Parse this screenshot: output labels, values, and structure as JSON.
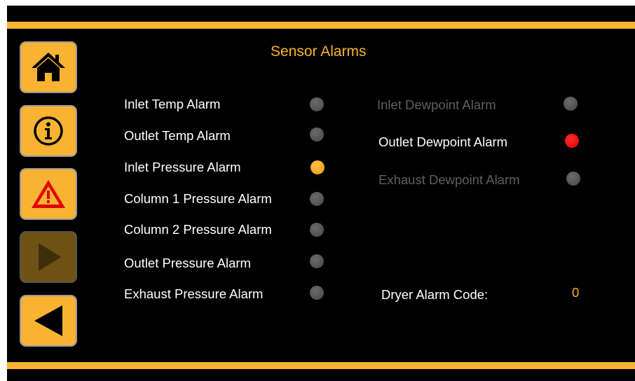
{
  "title": "Sensor Alarms",
  "nav": [
    {
      "name": "home",
      "icon": "home-icon",
      "enabled": true
    },
    {
      "name": "info",
      "icon": "info-icon",
      "enabled": true
    },
    {
      "name": "alarms",
      "icon": "warning-icon",
      "enabled": true
    },
    {
      "name": "next",
      "icon": "play-right-icon",
      "enabled": false
    },
    {
      "name": "back",
      "icon": "arrow-left-icon",
      "enabled": true
    }
  ],
  "left_alarms": [
    {
      "label": "Inlet Temp Alarm",
      "state": "off"
    },
    {
      "label": "Outlet Temp Alarm",
      "state": "off"
    },
    {
      "label": "Inlet Pressure Alarm",
      "state": "yellow"
    },
    {
      "label": "Column 1 Pressure Alarm",
      "state": "off"
    },
    {
      "label": "Column 2 Pressure Alarm",
      "state": "off"
    },
    {
      "label": "Outlet Pressure Alarm",
      "state": "off"
    },
    {
      "label": "Exhaust Pressure Alarm",
      "state": "off"
    }
  ],
  "right_alarms": [
    {
      "label": "Inlet Dewpoint Alarm",
      "state": "off",
      "dimmed": true
    },
    {
      "label": "Outlet Dewpoint Alarm",
      "state": "red",
      "dimmed": false
    },
    {
      "label": "Exhaust Dewpoint Alarm",
      "state": "off",
      "dimmed": true
    }
  ],
  "alarm_code": {
    "label": "Dryer Alarm Code:",
    "value": "0"
  },
  "colors": {
    "accent": "#f8b332",
    "background": "#000000",
    "alarm_red": "#ff0000",
    "led_off": "#555555"
  }
}
